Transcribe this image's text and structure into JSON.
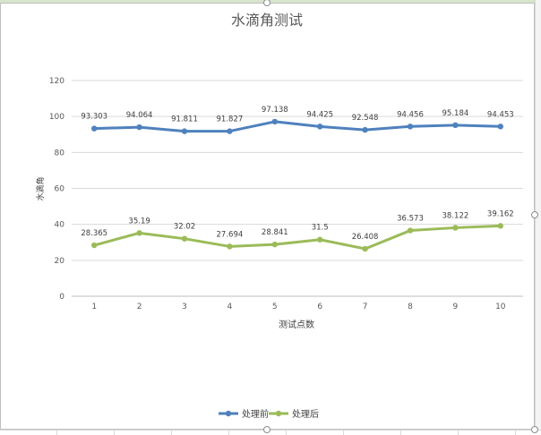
{
  "chart_data": {
    "type": "line",
    "title": "水滴角测试",
    "xlabel": "测试点数",
    "ylabel": "水滴角",
    "categories": [
      "1",
      "2",
      "3",
      "4",
      "5",
      "6",
      "7",
      "8",
      "9",
      "10"
    ],
    "ylim": [
      0,
      120
    ],
    "yticks": [
      0,
      20,
      40,
      60,
      80,
      100,
      120
    ],
    "grid": true,
    "legend": "bottom",
    "series": [
      {
        "name": "处理前",
        "color": "#4f81bd",
        "values": [
          93.303,
          94.064,
          91.811,
          91.827,
          97.138,
          94.425,
          92.548,
          94.456,
          95.184,
          94.453
        ],
        "labels": [
          "93.303",
          "94.064",
          "91.811",
          "91.827",
          "97.138",
          "94.425",
          "92.548",
          "94.456",
          "95.184",
          "94.453"
        ]
      },
      {
        "name": "处理后",
        "color": "#9bbb59",
        "values": [
          28.365,
          35.19,
          32.02,
          27.694,
          28.841,
          31.5,
          26.408,
          36.573,
          38.122,
          39.162
        ],
        "labels": [
          "28.365",
          "35.19",
          "32.02",
          "27.694",
          "28.841",
          "31.5",
          "26.408",
          "36.573",
          "38.122",
          "39.162"
        ]
      }
    ]
  }
}
